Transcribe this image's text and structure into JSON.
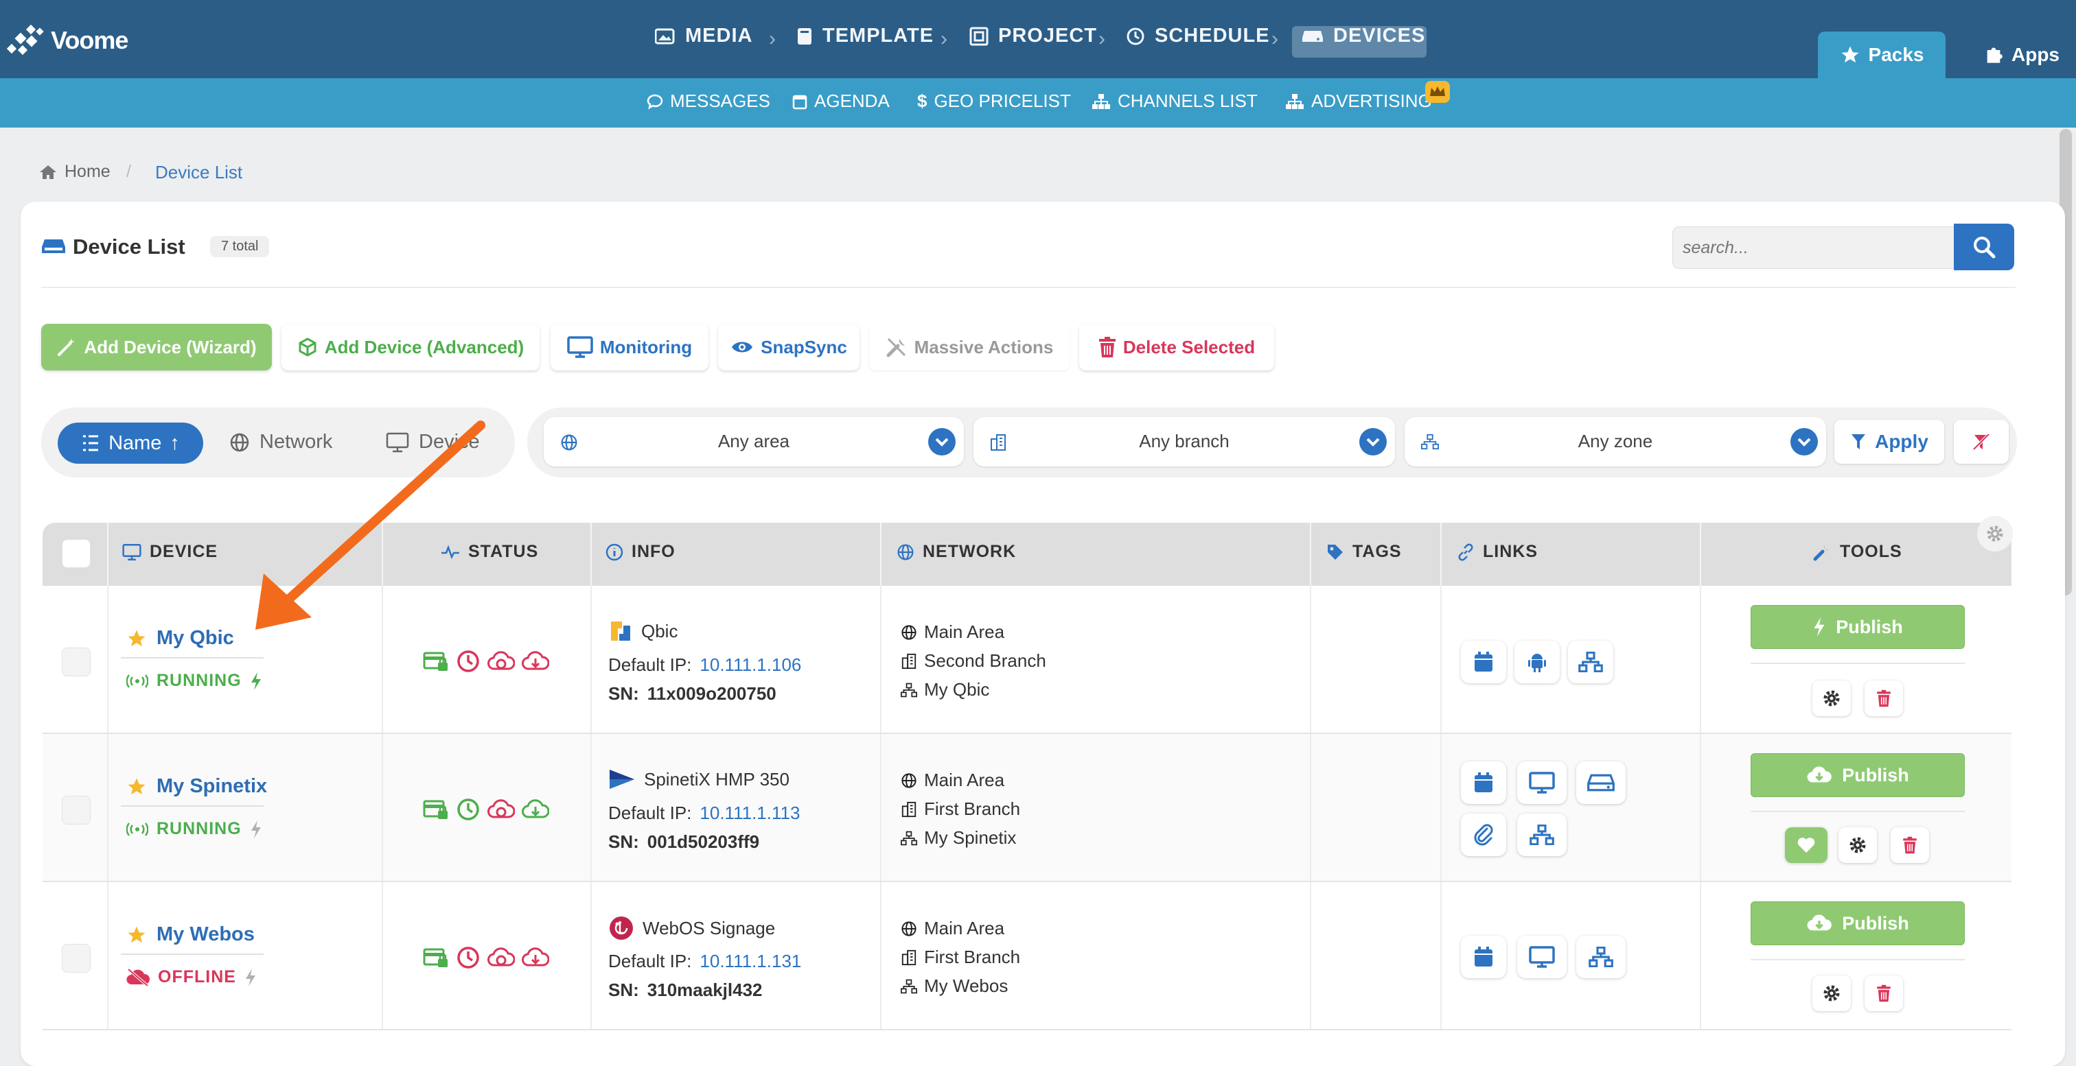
{
  "app": {
    "name": "Voome"
  },
  "nav": {
    "main": [
      {
        "label": "MEDIA",
        "icon": "image-icon"
      },
      {
        "label": "TEMPLATE",
        "icon": "book-icon"
      },
      {
        "label": "PROJECT",
        "icon": "project-icon"
      },
      {
        "label": "SCHEDULE",
        "icon": "clock-icon"
      },
      {
        "label": "DEVICES",
        "icon": "device-icon",
        "active": true
      }
    ],
    "right": [
      {
        "label": "Packs",
        "icon": "star-icon",
        "active": true
      },
      {
        "label": "Apps",
        "icon": "puzzle-icon"
      }
    ],
    "sub": [
      {
        "label": "MESSAGES",
        "icon": "chat-icon"
      },
      {
        "label": "AGENDA",
        "icon": "calendar-icon"
      },
      {
        "label": "GEO PRICELIST",
        "icon": "dollar-icon"
      },
      {
        "label": "CHANNELS LIST",
        "icon": "sitemap-icon"
      },
      {
        "label": "ADVERTISING",
        "icon": "sitemap-icon",
        "badge_icon": "crown-icon"
      }
    ]
  },
  "breadcrumb": {
    "home": "Home",
    "current": "Device List"
  },
  "header": {
    "title": "Device List",
    "total": "7 total"
  },
  "search": {
    "placeholder": "search...",
    "value": ""
  },
  "actions": [
    {
      "label": "Add Device (Wizard)",
      "icon": "magic-wand-icon",
      "style": "primary-green"
    },
    {
      "label": "Add Device (Advanced)",
      "icon": "box-add-icon",
      "style": "outline-green"
    },
    {
      "label": "Monitoring",
      "icon": "monitor-icon",
      "style": "outline-blue"
    },
    {
      "label": "SnapSync",
      "icon": "eye-icon",
      "style": "outline-blue"
    },
    {
      "label": "Massive Actions",
      "icon": "tools-icon",
      "style": "disabled"
    },
    {
      "label": "Delete Selected",
      "icon": "trash-icon",
      "style": "outline-red"
    }
  ],
  "sort": {
    "options": [
      {
        "label": "Name",
        "icon": "list-sort-icon",
        "active": true,
        "direction": "↑"
      },
      {
        "label": "Network",
        "icon": "globe-icon"
      },
      {
        "label": "Device",
        "icon": "monitor-icon"
      }
    ]
  },
  "filters": {
    "area": "Any area",
    "branch": "Any branch",
    "zone": "Any zone",
    "apply_label": "Apply"
  },
  "table": {
    "columns": [
      {
        "label": "DEVICE",
        "icon": "monitor-icon"
      },
      {
        "label": "STATUS",
        "icon": "pulse-icon"
      },
      {
        "label": "INFO",
        "icon": "info-icon"
      },
      {
        "label": "NETWORK",
        "icon": "globe-icon"
      },
      {
        "label": "TAGS",
        "icon": "tag-icon"
      },
      {
        "label": "LINKS",
        "icon": "link-icon"
      },
      {
        "label": "TOOLS",
        "icon": "wrench-icon"
      }
    ],
    "rows": [
      {
        "name": "My Qbic",
        "status": "RUNNING",
        "status_color": "#4cae4c",
        "power_color": "#4cae4c",
        "model": "Qbic",
        "ip_label": "Default IP:",
        "ip": "10.111.1.106",
        "sn_label": "SN:",
        "sn": "11x009o200750",
        "area": "Main Area",
        "branch": "Second Branch",
        "zone": "My Qbic",
        "links": [
          "calendar-icon",
          "android-icon",
          "sitemap-icon"
        ],
        "publish_label": "Publish",
        "publish_icon": "bolt-icon",
        "tools": [
          "gear-icon",
          "trash-icon"
        ]
      },
      {
        "name": "My Spinetix",
        "status": "RUNNING",
        "status_color": "#4cae4c",
        "power_color": "#b0b0b0",
        "model": "SpinetiX HMP 350",
        "ip_label": "Default IP:",
        "ip": "10.111.1.113",
        "sn_label": "SN:",
        "sn": "001d50203ff9",
        "area": "Main Area",
        "branch": "First Branch",
        "zone": "My Spinetix",
        "links": [
          "calendar-icon",
          "monitor-icon",
          "hdd-icon",
          "paperclip-icon",
          "sitemap-icon"
        ],
        "publish_label": "Publish",
        "publish_icon": "cloud-download-icon",
        "tools": [
          "heart-icon",
          "gear-icon",
          "trash-icon"
        ]
      },
      {
        "name": "My Webos",
        "status": "OFFLINE",
        "status_color": "#d9365a",
        "power_color": "#b0b0b0",
        "model": "WebOS Signage",
        "ip_label": "Default IP:",
        "ip": "10.111.1.131",
        "sn_label": "SN:",
        "sn": "310maakjl432",
        "area": "Main Area",
        "branch": "First Branch",
        "zone": "My Webos",
        "links": [
          "calendar-icon",
          "monitor-icon",
          "sitemap-icon"
        ],
        "publish_label": "Publish",
        "publish_icon": "cloud-download-icon",
        "tools": [
          "gear-icon",
          "trash-icon"
        ]
      }
    ]
  },
  "colors": {
    "brand_dark": "#2b5d87",
    "brand_light": "#3a9dc7",
    "accent_blue": "#2d73c2",
    "green": "#8fca73",
    "red": "#d9365a",
    "arrow": "#f26b1d"
  }
}
